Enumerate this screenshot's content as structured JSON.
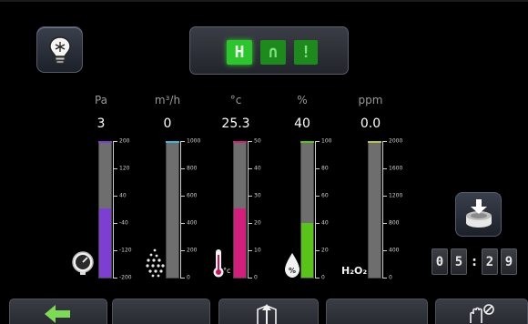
{
  "mode_display": {
    "segments": [
      "H",
      "∩",
      "!"
    ],
    "active_index": 0
  },
  "gauges": [
    {
      "unit": "Pa",
      "value": "3",
      "color": "#7d3fd1",
      "fill_fraction": 0.51,
      "ticks": [
        "200",
        "120",
        "40",
        "-40",
        "-120",
        "-200"
      ],
      "icon": "pressure-gauge-icon"
    },
    {
      "unit": "m³/h",
      "value": "0",
      "color": "#3fb5d8",
      "fill_fraction": 0.0,
      "ticks": [
        "1000",
        "800",
        "600",
        "400",
        "200",
        "0"
      ],
      "icon": "airflow-icon"
    },
    {
      "unit": "°c",
      "value": "25.3",
      "color": "#d21f7c",
      "fill_fraction": 0.51,
      "ticks": [
        "50",
        "40",
        "30",
        "20",
        "10",
        "0"
      ],
      "icon": "thermometer-icon",
      "icon_label": "°c"
    },
    {
      "unit": "%",
      "value": "40",
      "color": "#59c21b",
      "fill_fraction": 0.4,
      "ticks": [
        "100",
        "80",
        "60",
        "40",
        "20",
        "0"
      ],
      "icon": "humidity-drop-icon"
    },
    {
      "unit": "ppm",
      "value": "0.0",
      "color": "#bcc23a",
      "fill_fraction": 0.0,
      "ticks": [
        "2000",
        "1600",
        "1200",
        "800",
        "400",
        "0"
      ],
      "icon": "h2o2-icon",
      "icon_label": "H₂O₂"
    }
  ],
  "timer": {
    "d1": "0",
    "d2": "5",
    "sep": ":",
    "d3": "2",
    "d4": "9"
  },
  "colors": {
    "active_green": "#2ec42e",
    "panel_bg": "#000000"
  }
}
